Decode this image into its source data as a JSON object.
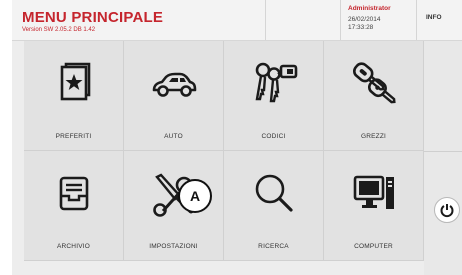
{
  "header": {
    "title": "MENU PRINCIPALE",
    "version": "Version SW 2.05.2 DB 1.42",
    "user": "Administrator",
    "date": "26/02/2014",
    "time": "17:33:28",
    "info_label": "INFO"
  },
  "tiles": [
    {
      "label": "PREFERITI",
      "icon": "favorites-star-card-icon"
    },
    {
      "label": "AUTO",
      "icon": "car-icon"
    },
    {
      "label": "CODICI",
      "icon": "keys-with-tag-icon"
    },
    {
      "label": "GREZZI",
      "icon": "key-blanks-icon"
    },
    {
      "label": "ARCHIVIO",
      "icon": "archive-tray-icon"
    },
    {
      "label": "IMPOSTAZIONI",
      "icon": "tools-wrench-screwdriver-icon"
    },
    {
      "label": "RICERCA",
      "icon": "magnifier-icon"
    },
    {
      "label": "COMPUTER",
      "icon": "computer-monitor-icon"
    }
  ],
  "callout": {
    "label": "A"
  },
  "colors": {
    "brand": "#c5252d",
    "background": "#ededed",
    "tile": "#e2e2e2"
  }
}
